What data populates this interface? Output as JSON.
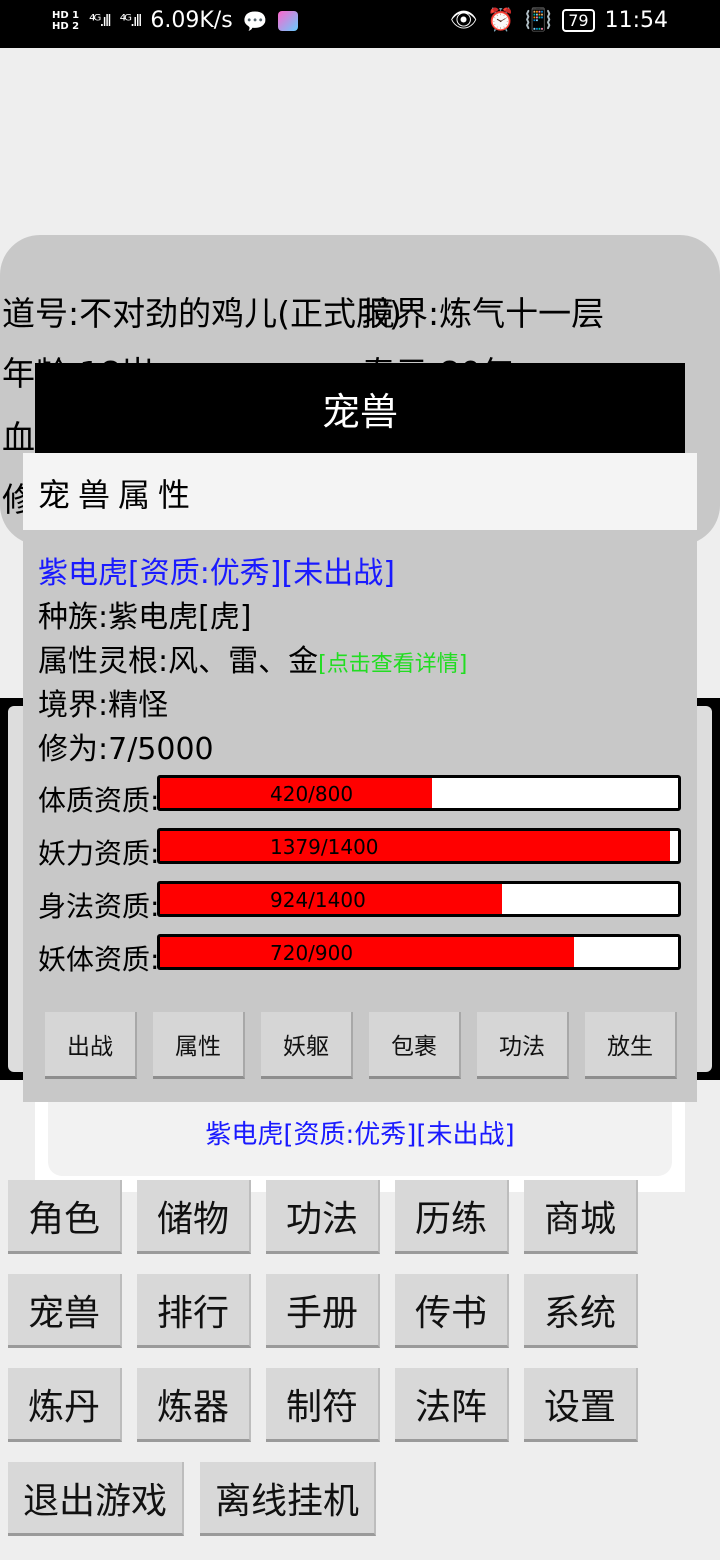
{
  "status_bar": {
    "hd1": "HD 1",
    "hd2": "HD 2",
    "signal1": "⁴ᴳ.ıll",
    "signal2": "⁴ᴳ.ıll",
    "net_speed": "6.09K/s",
    "battery": "79",
    "time": "11:54"
  },
  "character": {
    "dao_name": "道号:不对劲的鸡儿(正式服)",
    "realm": "境界:炼气十一层",
    "age": "年龄:18岁",
    "lifespan": "寿元:80年",
    "hp_prefix": "血",
    "cultivation_prefix": "修"
  },
  "dialog": {
    "title": "宠兽",
    "header": "宠兽属性",
    "pet_title": "紫电虎[资质:优秀][未出战]",
    "race": "种族:紫电虎[虎]",
    "root": "属性灵根:风、雷、金",
    "root_link": "[点击查看详情]",
    "realm": "境界:精怪",
    "cultivation": "修为:7/5000",
    "stats": [
      {
        "label": "体质资质:",
        "text": "420/800",
        "value": 420,
        "max": 800
      },
      {
        "label": "妖力资质:",
        "text": "1379/1400",
        "value": 1379,
        "max": 1400
      },
      {
        "label": "身法资质:",
        "text": "924/1400",
        "value": 924,
        "max": 1400
      },
      {
        "label": "妖体资质:",
        "text": "720/900",
        "value": 720,
        "max": 900
      }
    ],
    "actions": [
      "出战",
      "属性",
      "妖躯",
      "包裹",
      "功法",
      "放生"
    ]
  },
  "pet_list_item": "紫电虎[资质:优秀][未出战]",
  "menu": {
    "row1": [
      "角色",
      "储物",
      "功法",
      "历练",
      "商城"
    ],
    "row2": [
      "宠兽",
      "排行",
      "手册",
      "传书",
      "系统"
    ],
    "row3": [
      "炼丹",
      "炼器",
      "制符",
      "法阵",
      "设置"
    ],
    "row4": [
      "退出游戏",
      "离线挂机"
    ]
  },
  "colors": {
    "bar_fill": "#ff0000",
    "pet_title": "#1a1aff",
    "detail_link": "#22dd22"
  }
}
